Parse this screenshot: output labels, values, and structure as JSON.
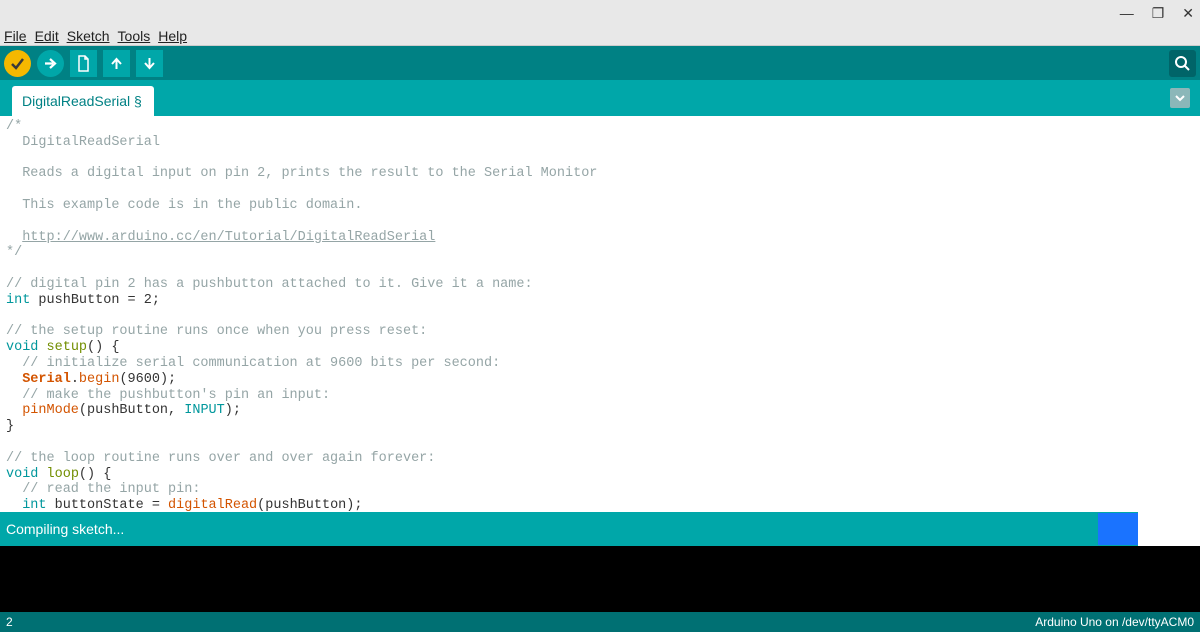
{
  "window": {
    "minimize": "—",
    "maximize": "❐",
    "close": "✕"
  },
  "menu": {
    "file": "File",
    "edit": "Edit",
    "sketch": "Sketch",
    "tools": "Tools",
    "help": "Help"
  },
  "tabs": {
    "active": "DigitalReadSerial §"
  },
  "status": {
    "message": "Compiling sketch...",
    "line_number": "2",
    "board_port": "Arduino Uno on /dev/ttyACM0"
  },
  "code": {
    "l0": "/*",
    "l1": "  DigitalReadSerial",
    "l2": "",
    "l3": "  Reads a digital input on pin 2, prints the result to the Serial Monitor",
    "l4": "",
    "l5": "  This example code is in the public domain.",
    "l6": "",
    "l7": "  ",
    "l7_link": "http://www.arduino.cc/en/Tutorial/DigitalReadSerial",
    "l8": "*/",
    "l9": "",
    "l10": "// digital pin 2 has a pushbutton attached to it. Give it a name:",
    "l11_a": "int",
    "l11_b": " pushButton = 2;",
    "l12": "",
    "l13": "// the setup routine runs once when you press reset:",
    "l14_a": "void",
    "l14_b": " ",
    "l14_c": "setup",
    "l14_d": "() {",
    "l15": "  // initialize serial communication at 9600 bits per second:",
    "l16_a": "  ",
    "l16_b": "Serial",
    "l16_c": ".",
    "l16_d": "begin",
    "l16_e": "(9600);",
    "l17": "  // make the pushbutton's pin an input:",
    "l18_a": "  ",
    "l18_b": "pinMode",
    "l18_c": "(pushButton, ",
    "l18_d": "INPUT",
    "l18_e": ");",
    "l19": "}",
    "l20": "",
    "l21": "// the loop routine runs over and over again forever:",
    "l22_a": "void",
    "l22_b": " ",
    "l22_c": "loop",
    "l22_d": "() {",
    "l23": "  // read the input pin:",
    "l24_a": "  ",
    "l24_b": "int",
    "l24_c": " buttonState = ",
    "l24_d": "digitalRead",
    "l24_e": "(pushButton);"
  }
}
